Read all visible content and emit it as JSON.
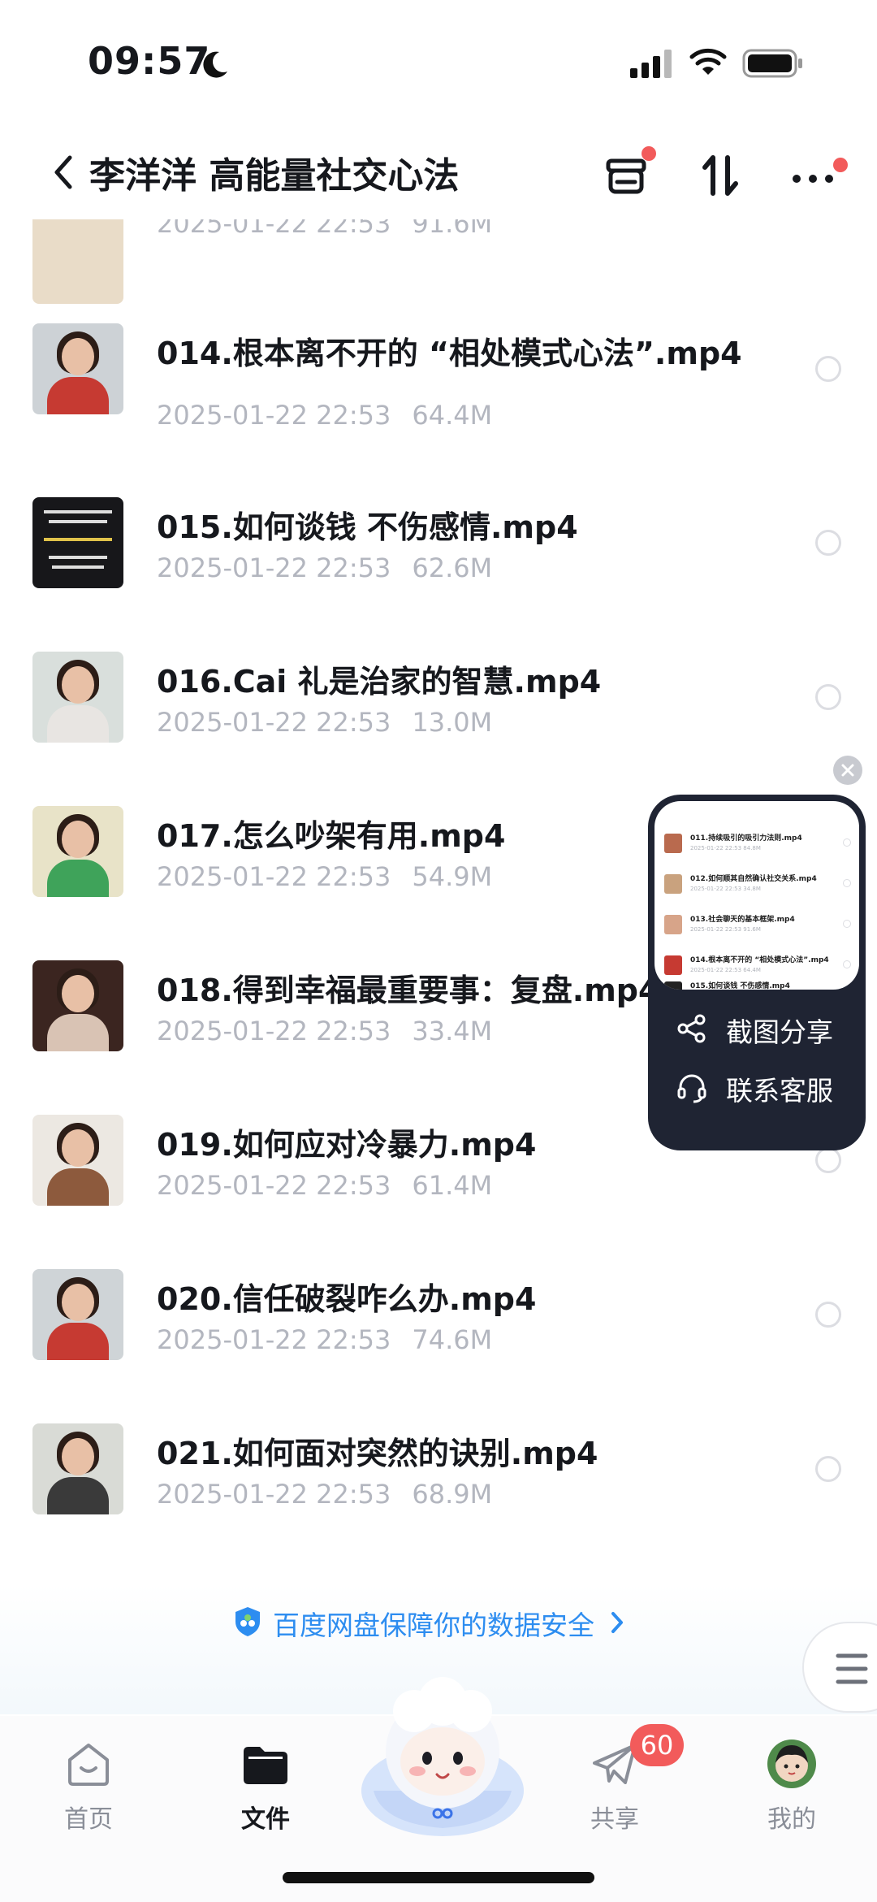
{
  "status_bar": {
    "time": "09:57"
  },
  "header": {
    "title": "李洋洋 高能量社交心法"
  },
  "files": [
    {
      "name": "",
      "date": "2025-01-22 22:53",
      "size": "91.6M"
    },
    {
      "name": "014.根本离不开的 “相处模式心法”.mp4",
      "date": "2025-01-22 22:53",
      "size": "64.4M"
    },
    {
      "name": "015.如何谈钱 不伤感情.mp4",
      "date": "2025-01-22 22:53",
      "size": "62.6M"
    },
    {
      "name": "016.Cai 礼是治家的智慧.mp4",
      "date": "2025-01-22 22:53",
      "size": "13.0M"
    },
    {
      "name": "017.怎么吵架有用.mp4",
      "date": "2025-01-22 22:53",
      "size": "54.9M"
    },
    {
      "name": "018.得到幸福最重要事：复盘.mp4",
      "date": "2025-01-22 22:53",
      "size": "33.4M"
    },
    {
      "name": "019.如何应对冷暴力.mp4",
      "date": "2025-01-22 22:53",
      "size": "61.4M"
    },
    {
      "name": "020.信任破裂咋么办.mp4",
      "date": "2025-01-22 22:53",
      "size": "74.6M"
    },
    {
      "name": "021.如何面对突然的诀别.mp4",
      "date": "2025-01-22 22:53",
      "size": "68.9M"
    }
  ],
  "floating_card": {
    "preview_rows": [
      {
        "name": "011.持续吸引的吸引力法则.mp4",
        "meta": "2025-01-22 22:53  84.8M"
      },
      {
        "name": "012.如何顺其自然确认社交关系.mp4",
        "meta": "2025-01-22 22:53  34.8M"
      },
      {
        "name": "013.社会聊天的基本框架.mp4",
        "meta": "2025-01-22 22:53  91.6M"
      },
      {
        "name": "014.根本离不开的 “相处模式心法”.mp4",
        "meta": "2025-01-22 22:53  64.4M"
      },
      {
        "name": "015.如何谈钱 不伤感情.mp4",
        "meta": ""
      }
    ],
    "share_label": "截图分享",
    "support_label": "联系客服"
  },
  "security_banner": {
    "text": "百度网盘保障你的数据安全"
  },
  "tabbar": {
    "home": "首页",
    "files": "文件",
    "share": "共享",
    "share_badge": "60",
    "me": "我的"
  },
  "colors": {
    "accent": "#2d8df0",
    "badge": "#f25b5b",
    "card": "#1f2433"
  }
}
